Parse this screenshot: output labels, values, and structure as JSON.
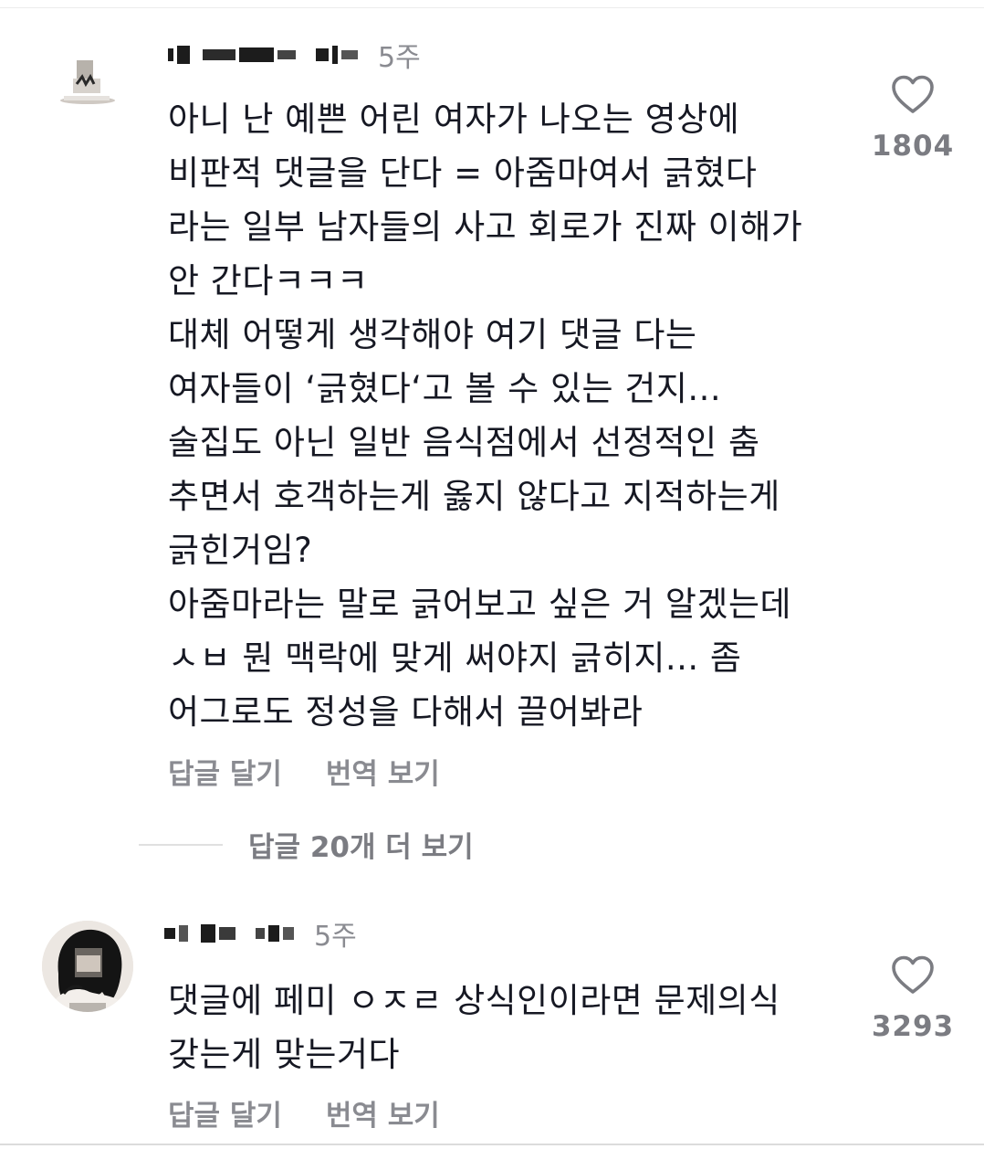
{
  "comments": [
    {
      "author": "",
      "time": "5주",
      "lines": [
        "아니 난 예쁜 어린 여자가 나오는 영상에",
        "비판적 댓글을 단다 = 아줌마여서 긁혔다",
        "라는 일부 남자들의 사고 회로가 진짜 이해가",
        "안 간다ㅋㅋㅋ",
        "대체 어떻게 생각해야 여기 댓글 다는",
        "여자들이 ‘긁혔다‘고 볼 수 있는 건지...",
        "술집도 아닌 일반 음식점에서 선정적인 춤",
        "추면서 호객하는게 옳지 않다고 지적하는게",
        "긁힌거임?",
        "아줌마라는 말로 긁어보고 싶은 거 알겠는데",
        "ㅅㅂ 뭔 맥락에 맞게 써야지 긁히지... 좀",
        "어그로도 정성을 다해서 끌어봐라"
      ],
      "reply_label": "답글 달기",
      "translate_label": "번역 보기",
      "like_count": "1804",
      "view_more_replies": "답글 20개 더 보기"
    },
    {
      "author": "",
      "time": "5주",
      "lines": [
        "댓글에 페미 ㅇㅈㄹ 상식인이라면 문제의식",
        "갖는게 맞는거다"
      ],
      "reply_label": "답글 달기",
      "translate_label": "번역 보기",
      "like_count": "3293"
    }
  ],
  "icons": {
    "like": "heart-outline-icon"
  },
  "colors": {
    "text": "#161823",
    "secondary": "#8a8b91"
  }
}
